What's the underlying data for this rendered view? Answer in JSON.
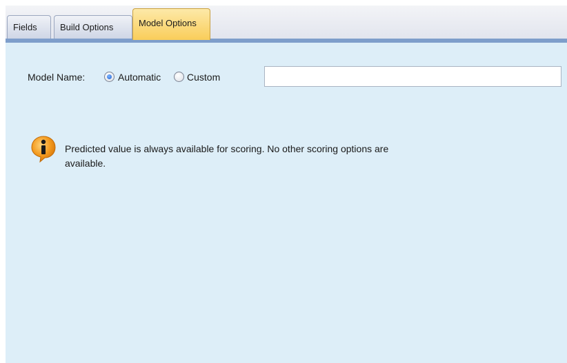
{
  "tabs": [
    {
      "label": "Fields",
      "active": false
    },
    {
      "label": "Build Options",
      "active": false
    },
    {
      "label": "Model Options",
      "active": true
    }
  ],
  "model_name": {
    "label": "Model Name:",
    "options": [
      {
        "label": "Automatic",
        "selected": true
      },
      {
        "label": "Custom",
        "selected": false
      }
    ],
    "custom_value": ""
  },
  "info": {
    "icon": "info-icon",
    "message": "Predicted value is always available for scoring. No other scoring options are available."
  },
  "colors": {
    "panel_background": "#ddeef8",
    "active_tab": "#f9cd5a",
    "tab_underline": "#7e9ecb",
    "info_icon": "#f39a1e"
  }
}
